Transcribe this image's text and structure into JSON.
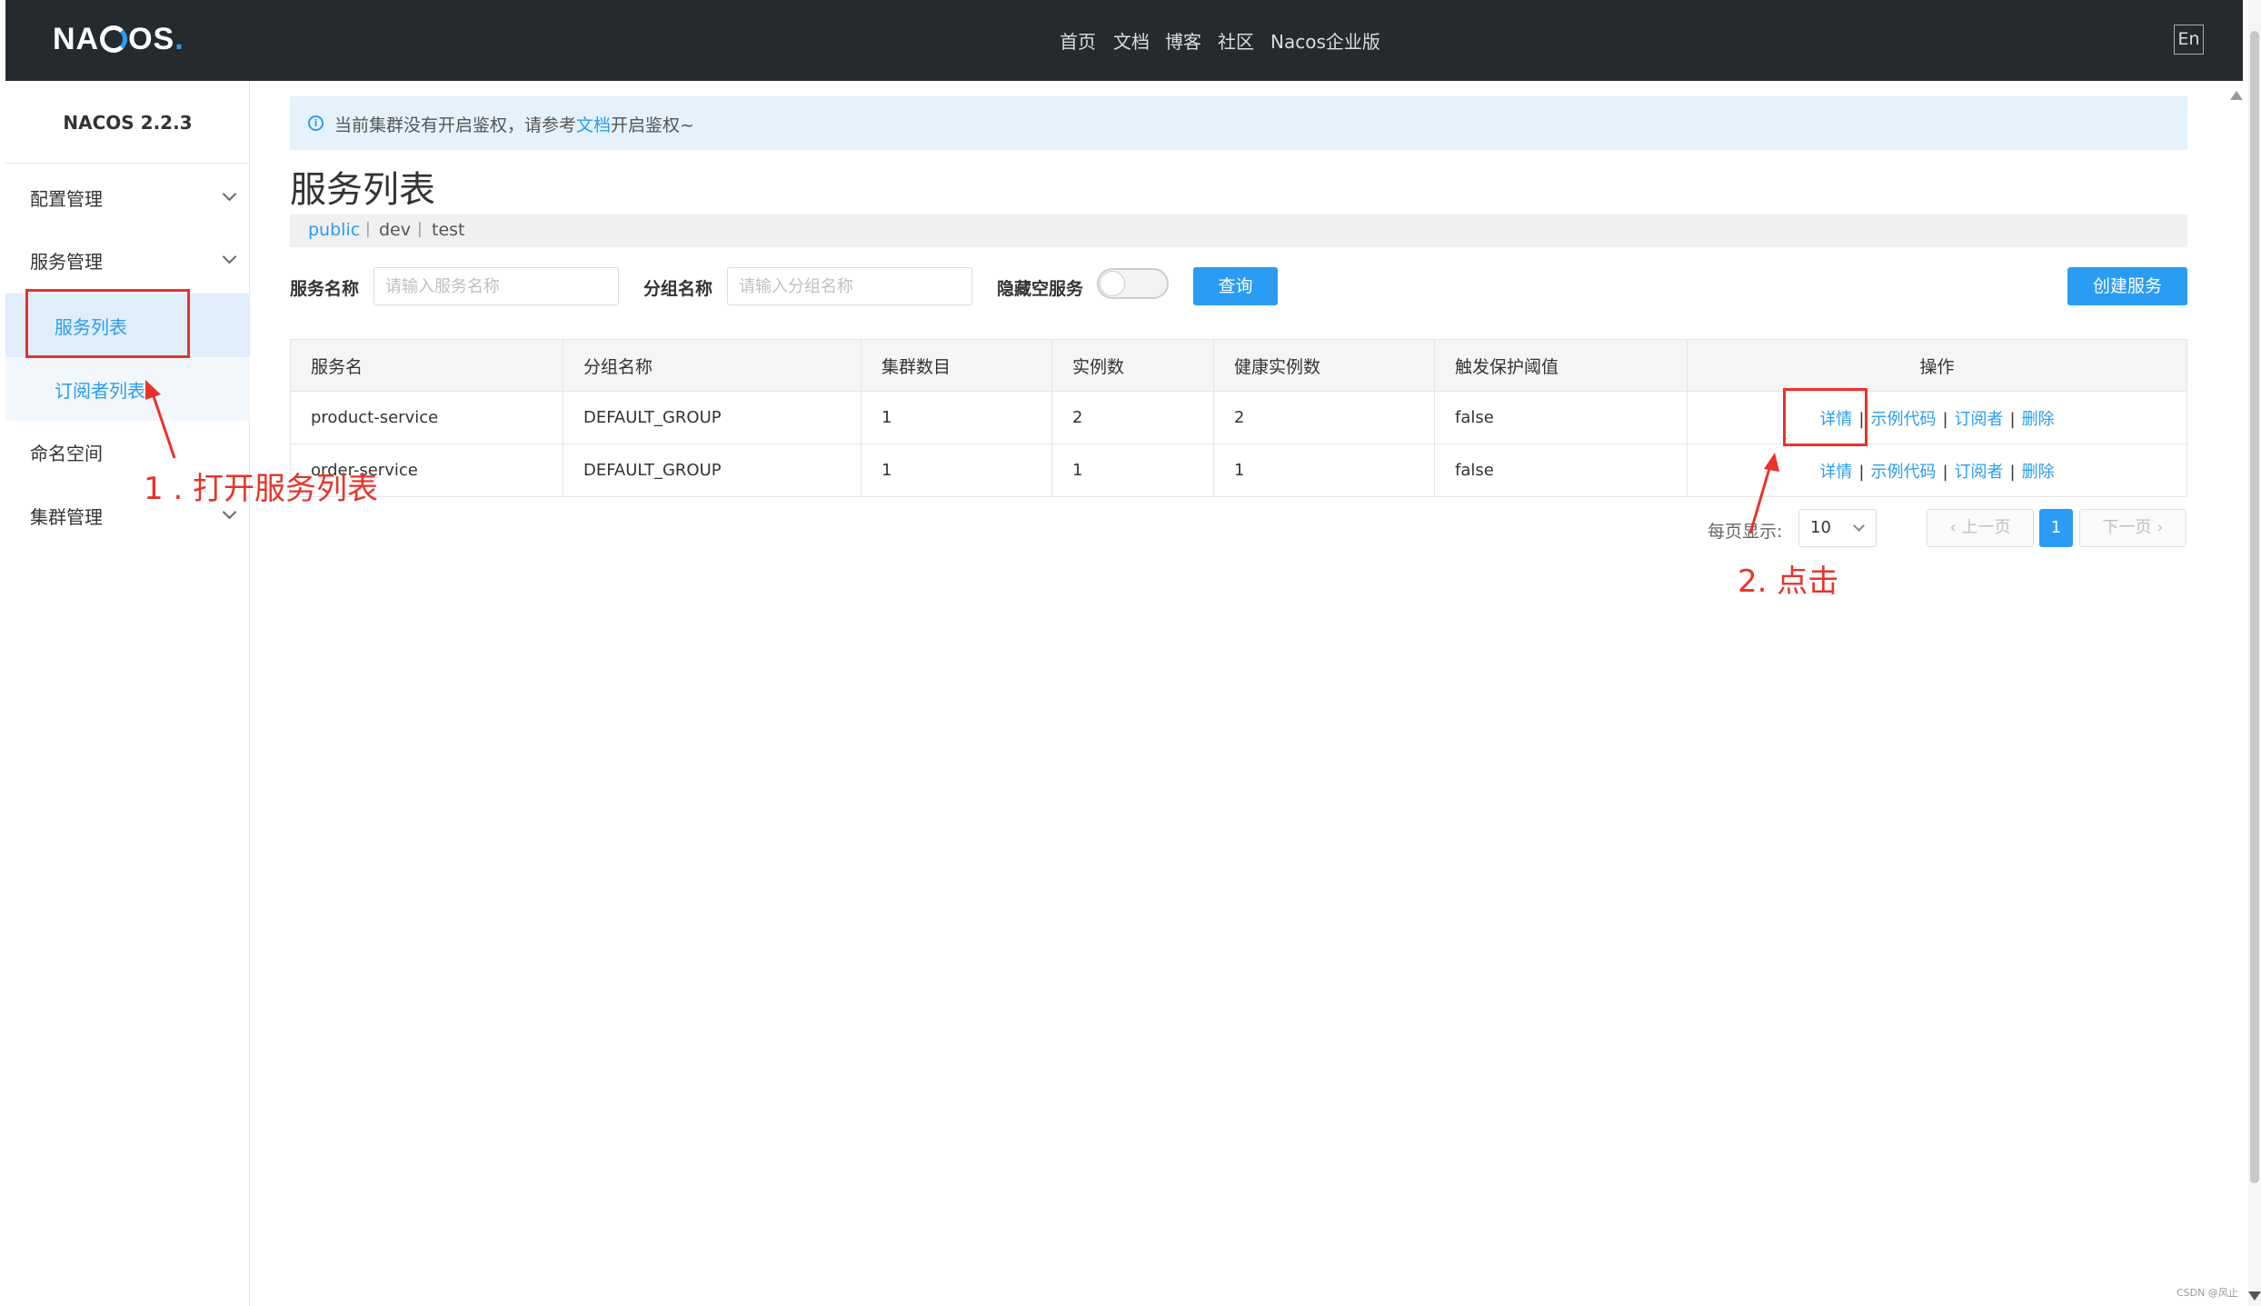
{
  "header": {
    "logo_text": "NACOS",
    "nav": [
      "首页",
      "文档",
      "博客",
      "社区",
      "Nacos企业版"
    ],
    "lang_button": "En"
  },
  "sidebar": {
    "version": "NACOS 2.2.3",
    "menu": [
      {
        "label": "配置管理",
        "expandable": true
      },
      {
        "label": "服务管理",
        "expandable": true
      },
      {
        "label": "命名空间",
        "expandable": false
      },
      {
        "label": "集群管理",
        "expandable": true
      }
    ],
    "sub_items": [
      "服务列表",
      "订阅者列表"
    ]
  },
  "annotations": {
    "note1": "1 . 打开服务列表",
    "note2": "2. 点击",
    "color": "#e8332a"
  },
  "alert": {
    "text_before": "当前集群没有开启鉴权，请参考",
    "link": "文档",
    "text_after": "开启鉴权~"
  },
  "page": {
    "title": "服务列表",
    "namespaces": [
      "public",
      "dev",
      "test"
    ],
    "active_namespace": "public"
  },
  "filters": {
    "service_name_label": "服务名称",
    "service_name_placeholder": "请输入服务名称",
    "group_name_label": "分组名称",
    "group_name_placeholder": "请输入分组名称",
    "hide_empty_label": "隐藏空服务",
    "hide_empty_on": false,
    "query_button": "查询",
    "create_button": "创建服务"
  },
  "table": {
    "columns": [
      "服务名",
      "分组名称",
      "集群数目",
      "实例数",
      "健康实例数",
      "触发保护阈值",
      "操作"
    ],
    "rows": [
      [
        "product-service",
        "DEFAULT_GROUP",
        "1",
        "2",
        "2",
        "false"
      ],
      [
        "order-service",
        "DEFAULT_GROUP",
        "1",
        "1",
        "1",
        "false"
      ]
    ],
    "actions": [
      "详情",
      "示例代码",
      "订阅者",
      "删除"
    ],
    "action_separator": "|"
  },
  "pagination": {
    "page_size_label": "每页显示:",
    "page_size": "10",
    "prev": "上一页",
    "next": "下一页",
    "current_page": "1"
  },
  "colors": {
    "topbar": "#252a2f",
    "accent": "#2a9cf3",
    "alert_bg": "#e5f2fc"
  },
  "watermark": "CSDN @风止"
}
